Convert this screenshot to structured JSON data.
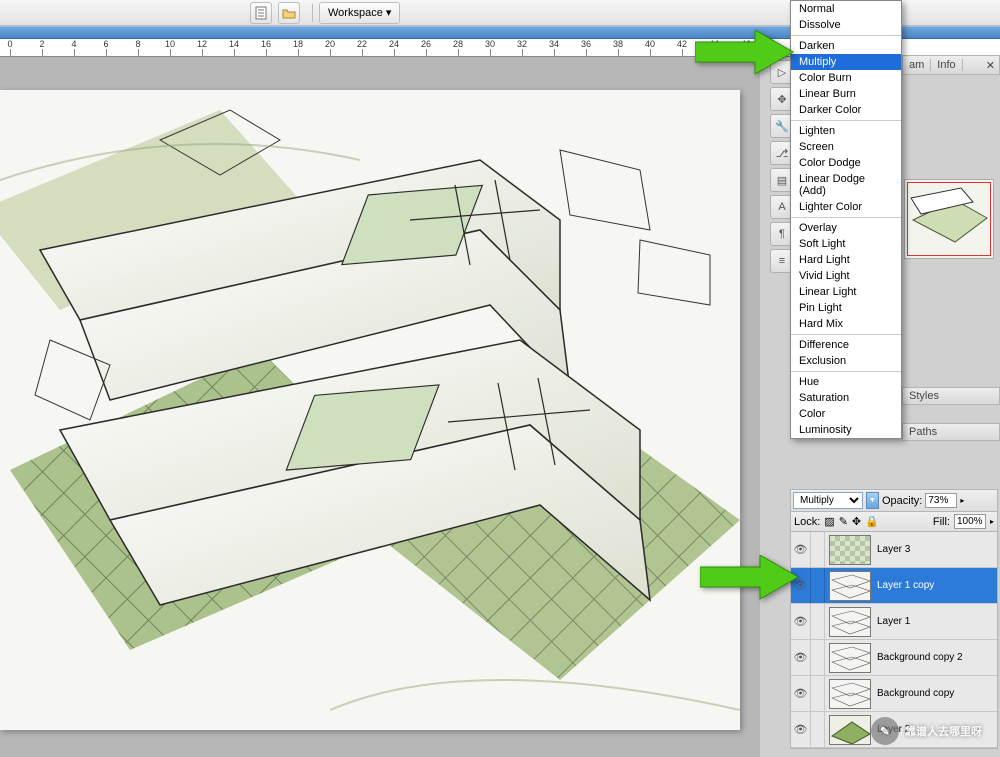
{
  "topbar": {
    "workspace_label": "Workspace ▾"
  },
  "ruler": {
    "start": 0,
    "end": 46,
    "step": 2
  },
  "blend_modes": {
    "groups": [
      [
        "Normal",
        "Dissolve"
      ],
      [
        "Darken",
        "Multiply",
        "Color Burn",
        "Linear Burn",
        "Darker Color"
      ],
      [
        "Lighten",
        "Screen",
        "Color Dodge",
        "Linear Dodge (Add)",
        "Lighter Color"
      ],
      [
        "Overlay",
        "Soft Light",
        "Hard Light",
        "Vivid Light",
        "Linear Light",
        "Pin Light",
        "Hard Mix"
      ],
      [
        "Difference",
        "Exclusion"
      ],
      [
        "Hue",
        "Saturation",
        "Color",
        "Luminosity"
      ]
    ],
    "selected": "Multiply"
  },
  "right_panels": {
    "tabs1": [
      "am",
      "Info"
    ],
    "tabs_styles": "Styles",
    "tabs_paths": "Paths",
    "blend_select": "Multiply",
    "opacity_label": "Opacity:",
    "opacity_value": "73%",
    "lock_label": "Lock:",
    "fill_label": "Fill:",
    "fill_value": "100%"
  },
  "layers": [
    {
      "name": "Layer 3",
      "thumb": "checker",
      "sel": false
    },
    {
      "name": "Layer 1 copy",
      "thumb": "sketch",
      "sel": true
    },
    {
      "name": "Layer 1",
      "thumb": "sketch",
      "sel": false
    },
    {
      "name": "Background copy 2",
      "thumb": "sketch",
      "sel": false
    },
    {
      "name": "Background copy",
      "thumb": "sketch",
      "sel": false
    },
    {
      "name": "Layer 2",
      "thumb": "green",
      "sel": false
    }
  ],
  "tool_icons": [
    "triangle",
    "arrows-move",
    "wrench",
    "branch",
    "layers",
    "text-A",
    "pilcrow",
    "list"
  ],
  "watermark": {
    "text": "靠谱人去哪里呀",
    "chat_glyph": "✎"
  }
}
